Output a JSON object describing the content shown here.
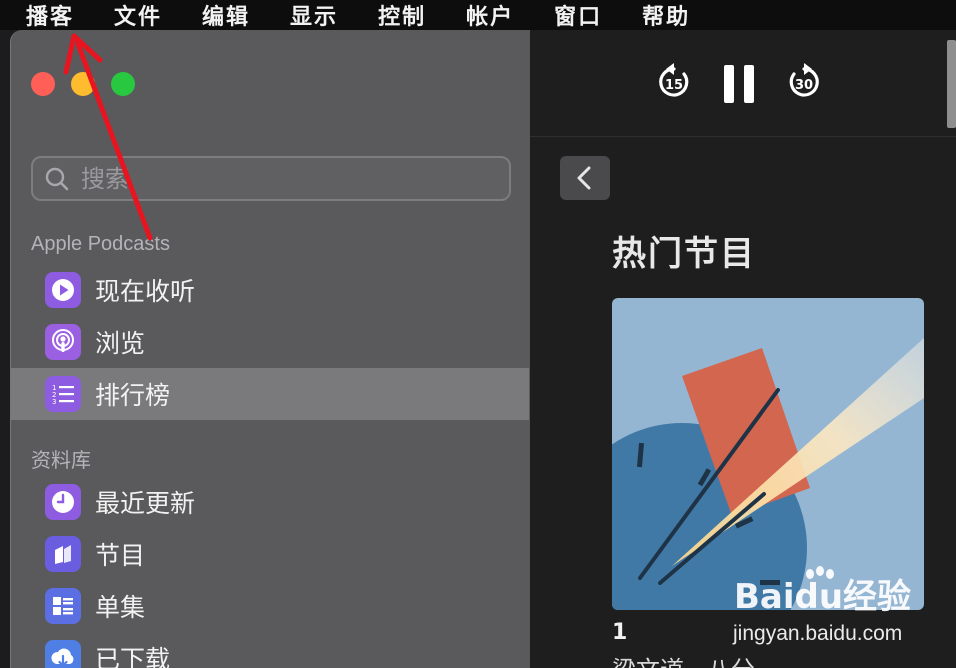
{
  "menubar": {
    "items": [
      "播客",
      "文件",
      "编辑",
      "显示",
      "控制",
      "帐户",
      "窗口",
      "帮助"
    ]
  },
  "search": {
    "placeholder": "搜索"
  },
  "sidebar": {
    "section_podcasts": "Apple Podcasts",
    "podcasts_items": [
      {
        "label": "现在收听",
        "icon": "play-circle-icon"
      },
      {
        "label": "浏览",
        "icon": "podcast-icon"
      },
      {
        "label": "排行榜",
        "icon": "list-numbered-icon",
        "selected": true
      }
    ],
    "section_library": "资料库",
    "library_items": [
      {
        "label": "最近更新",
        "icon": "clock-icon"
      },
      {
        "label": "节目",
        "icon": "shows-icon"
      },
      {
        "label": "单集",
        "icon": "episodes-icon"
      },
      {
        "label": "已下载",
        "icon": "download-icon"
      }
    ]
  },
  "player": {
    "skip_back_seconds": "15",
    "skip_forward_seconds": "30",
    "state": "playing"
  },
  "main": {
    "heading": "热门节目",
    "top_show": {
      "rank": "1",
      "title": "梁文道 · 八分"
    }
  },
  "watermark": {
    "brand": "Baidu经验",
    "url": "jingyan.baidu.com"
  },
  "colors": {
    "accent_purple": "#8d5ce0",
    "selection": "#7a7a7d",
    "annotation_red": "#e8141f"
  }
}
